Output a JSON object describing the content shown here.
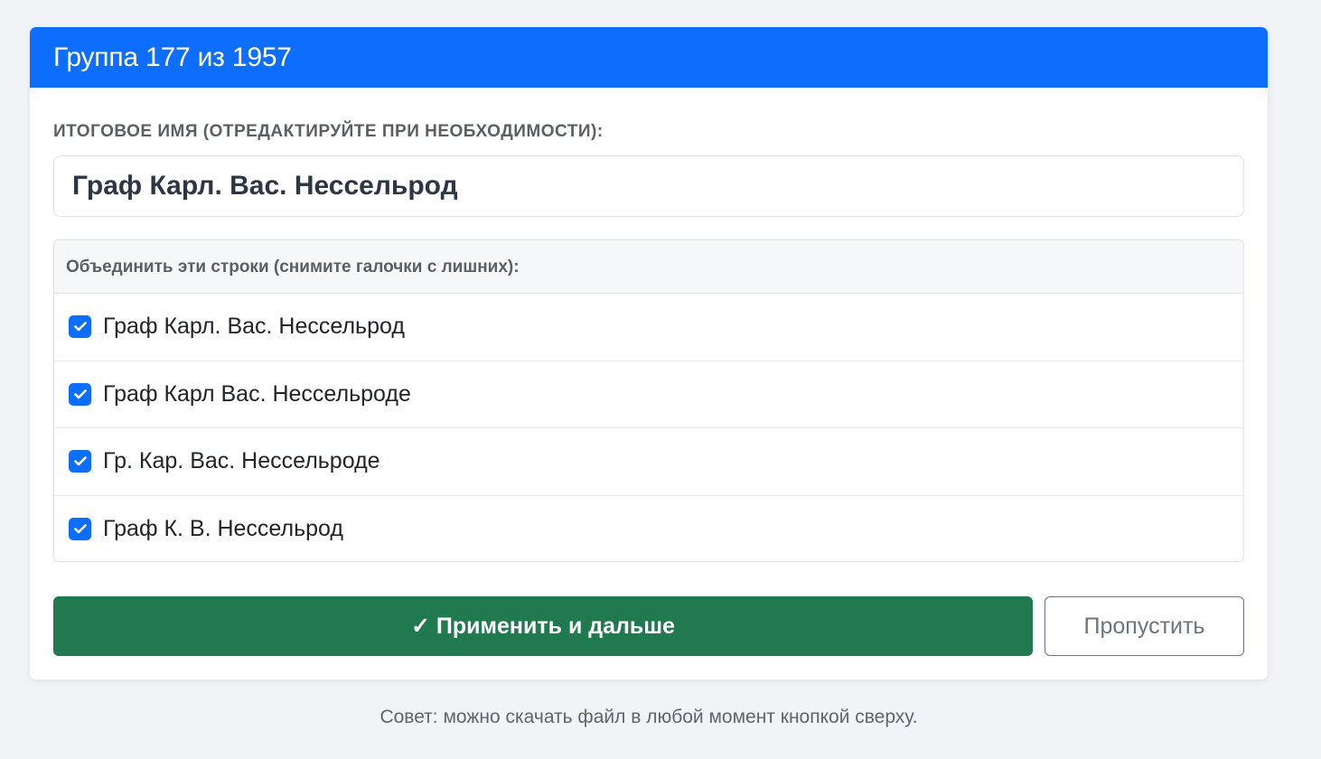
{
  "header": {
    "title": "Группа 177 из 1957"
  },
  "form": {
    "label": "Итоговое имя (отредактируйте при необходимости):",
    "name_value": "Граф Карл. Вас. Нессельрод"
  },
  "merge": {
    "header": "Объединить эти строки (снимите галочки с лишних):",
    "items": [
      {
        "label": "Граф Карл. Вас. Нессельрод",
        "checked": true
      },
      {
        "label": "Граф Карл Вас. Нессельроде",
        "checked": true
      },
      {
        "label": "Гр. Кар. Вас. Нессельроде",
        "checked": true
      },
      {
        "label": "Граф К. В. Нессельрод",
        "checked": true
      }
    ]
  },
  "actions": {
    "apply_check": "✓",
    "apply_label": "Применить и дальше",
    "skip_label": "Пропустить"
  },
  "hint": "Совет: можно скачать файл в любой момент кнопкой сверху.",
  "colors": {
    "primary": "#0d6efd",
    "success": "#217a4f",
    "secondary": "#6c757d"
  }
}
